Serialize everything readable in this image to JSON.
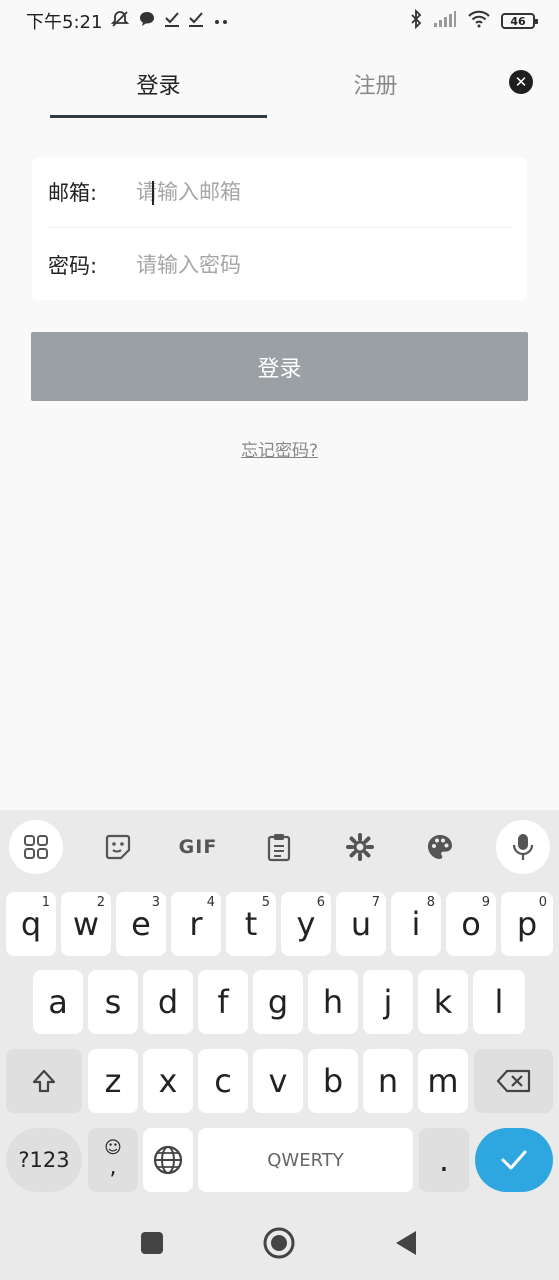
{
  "status_bar": {
    "time": "下午5:21",
    "battery": "46"
  },
  "tabs": [
    {
      "label": "登录",
      "active": true
    },
    {
      "label": "注册",
      "active": false
    }
  ],
  "form": {
    "email_label": "邮箱:",
    "email_placeholder": "请输入邮箱",
    "password_label": "密码:",
    "password_placeholder": "请输入密码"
  },
  "login_button": "登录",
  "forgot_password": "忘记密码?",
  "keyboard": {
    "row1": [
      {
        "key": "q",
        "hint": "1"
      },
      {
        "key": "w",
        "hint": "2"
      },
      {
        "key": "e",
        "hint": "3"
      },
      {
        "key": "r",
        "hint": "4"
      },
      {
        "key": "t",
        "hint": "5"
      },
      {
        "key": "y",
        "hint": "6"
      },
      {
        "key": "u",
        "hint": "7"
      },
      {
        "key": "i",
        "hint": "8"
      },
      {
        "key": "o",
        "hint": "9"
      },
      {
        "key": "p",
        "hint": "0"
      }
    ],
    "row2": [
      "a",
      "s",
      "d",
      "f",
      "g",
      "h",
      "j",
      "k",
      "l"
    ],
    "row3": [
      "z",
      "x",
      "c",
      "v",
      "b",
      "n",
      "m"
    ],
    "symbols_key": "?123",
    "comma_key": ",",
    "space_label": "QWERTY",
    "period_key": ".",
    "toolbar_gif": "GIF"
  },
  "colors": {
    "accent": "#2ea7e0",
    "login_button_bg": "#9aa0a4",
    "tab_indicator": "#333b45"
  }
}
